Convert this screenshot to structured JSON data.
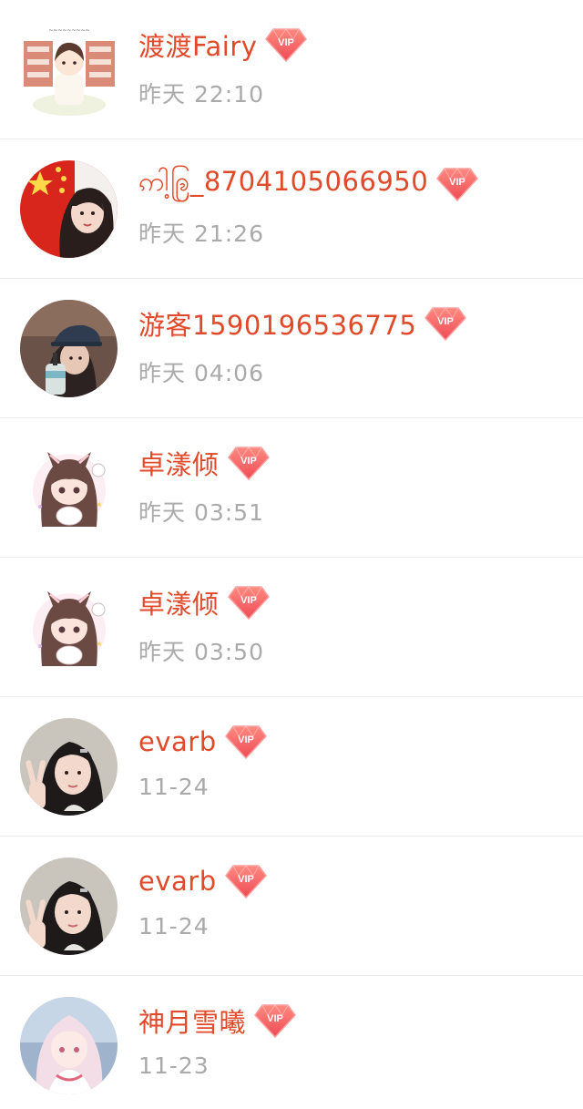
{
  "colors": {
    "name": "#e04a2a",
    "time": "#aaaaaa",
    "vip_badge": "#f0605a",
    "divider": "#ececec"
  },
  "badge_icon": "vip-diamond-icon",
  "entries": [
    {
      "name": "渡渡Fairy",
      "badge": "VIP",
      "time": "昨天 22:10",
      "avatar": "sticker-girl-avatar"
    },
    {
      "name": "ဢါ့ဨြ_8704105066950",
      "badge": "VIP",
      "time": "昨天 21:26",
      "avatar": "flag-girl-avatar"
    },
    {
      "name": "游客1590196536775",
      "badge": "VIP",
      "time": "昨天 04:06",
      "avatar": "cap-girl-avatar"
    },
    {
      "name": "卓漾倾",
      "badge": "VIP",
      "time": "昨天 03:51",
      "avatar": "cartoon-girl-avatar"
    },
    {
      "name": "卓漾倾",
      "badge": "VIP",
      "time": "昨天 03:50",
      "avatar": "cartoon-girl-avatar"
    },
    {
      "name": "evarb",
      "badge": "VIP",
      "time": "11-24",
      "avatar": "peace-sign-girl-avatar"
    },
    {
      "name": "evarb",
      "badge": "VIP",
      "time": "11-24",
      "avatar": "peace-sign-girl-avatar"
    },
    {
      "name": "神月雪曦",
      "badge": "VIP",
      "time": "11-23",
      "avatar": "anime-girl-avatar"
    }
  ]
}
